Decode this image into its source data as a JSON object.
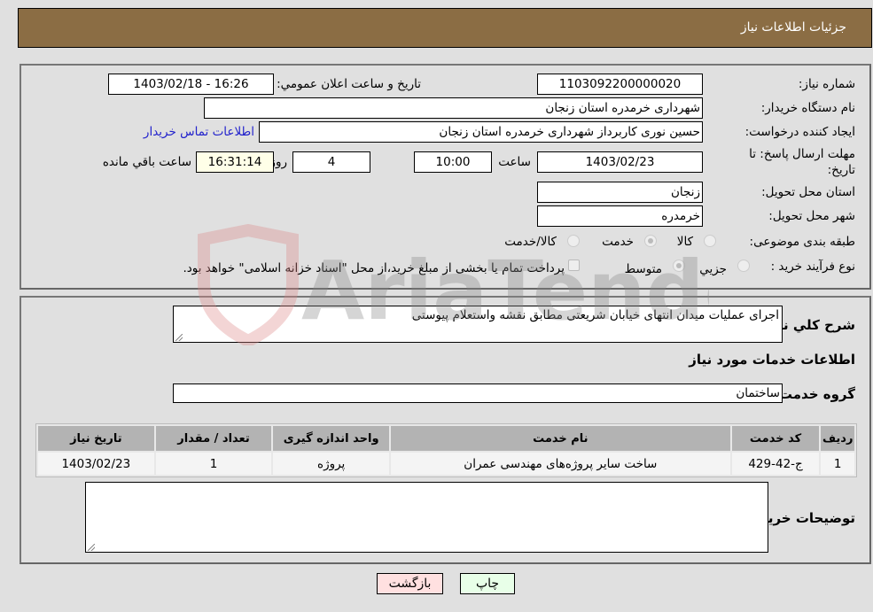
{
  "header": {
    "title": "جزئیات اطلاعات نیاز"
  },
  "details": {
    "need_number_label": "شماره نیاز:",
    "need_number": "1103092200000020",
    "announce_label": "تاریخ و ساعت اعلان عمومي:",
    "announce_value": "1403/02/18 - 16:26",
    "buyer_org_label": "نام دستگاه خریدار:",
    "buyer_org": "شهرداری خرمدره استان زنجان",
    "creator_label": "ایجاد کننده درخواست:",
    "creator": "حسین نوری کاربرداز شهرداری خرمدره استان زنجان",
    "contact_link": "اطلاعات تماس خریدار",
    "deadline_label": "مهلت ارسال پاسخ: تا تاریخ:",
    "deadline_date": "1403/02/23",
    "time_label": "ساعت",
    "deadline_time": "10:00",
    "days_value": "4",
    "days_label": "روز و",
    "remaining_time": "16:31:14",
    "remaining_label": "ساعت باقي مانده",
    "province_label": "استان محل تحویل:",
    "province": "زنجان",
    "city_label": "شهر محل تحویل:",
    "city": "خرمدره",
    "category_label": "طبقه بندی موضوعی:",
    "category_options": [
      {
        "label": "کالا",
        "selected": false
      },
      {
        "label": "خدمت",
        "selected": true
      },
      {
        "label": "کالا/خدمت",
        "selected": false
      }
    ],
    "process_label": "نوع فرآیند خرید :",
    "process_options": [
      {
        "label": "جزيي",
        "selected": false
      },
      {
        "label": "متوسط",
        "selected": true
      }
    ],
    "treasury_note": "پرداخت تمام یا بخشی از مبلغ خرید،از محل \"اسناد خزانه اسلامی\" خواهد بود."
  },
  "summary": {
    "label": "شرح کلي نیاز:",
    "value": "اجرای عملیات میدان انتهای خیابان شریعتی مطابق نقشه واستعلام پیوستی"
  },
  "services": {
    "section_title": "اطلاعات خدمات مورد نیاز",
    "group_label": "گروه خدمت:",
    "group_value": "ساختمان",
    "columns": [
      "ردیف",
      "کد خدمت",
      "نام خدمت",
      "واحد اندازه گیری",
      "تعداد / مقدار",
      "تاریخ نیاز"
    ],
    "rows": [
      [
        "1",
        "ج-42-429",
        "ساخت سایر پروژه‌های مهندسی عمران",
        "پروژه",
        "1",
        "1403/02/23"
      ]
    ]
  },
  "buyer_notes": {
    "label": "توضیحات خریدار:",
    "value": ""
  },
  "buttons": {
    "print": "چاپ",
    "back": "بازگشت"
  },
  "watermark": {
    "text": "AriaTender.neT"
  }
}
